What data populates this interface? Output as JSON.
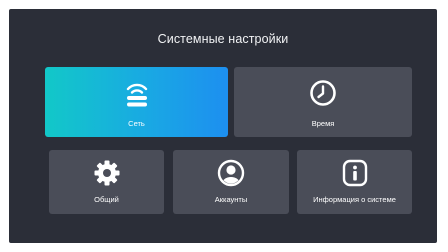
{
  "header": {
    "title": "Системные настройки"
  },
  "tiles": [
    {
      "id": "network",
      "label": "Сеть",
      "icon": "router-wifi-icon",
      "selected": true
    },
    {
      "id": "time",
      "label": "Время",
      "icon": "clock-icon",
      "selected": false
    },
    {
      "id": "general",
      "label": "Общий",
      "icon": "gear-icon",
      "selected": false
    },
    {
      "id": "accounts",
      "label": "Аккаунты",
      "icon": "user-icon",
      "selected": false
    },
    {
      "id": "info",
      "label": "Информация о системе",
      "icon": "info-icon",
      "selected": false
    }
  ],
  "colors": {
    "background": "#2b2e38",
    "tile": "#4a4d58",
    "active_gradient_start": "#12c8c8",
    "active_gradient_end": "#1d8ff0",
    "text": "#ffffff"
  }
}
